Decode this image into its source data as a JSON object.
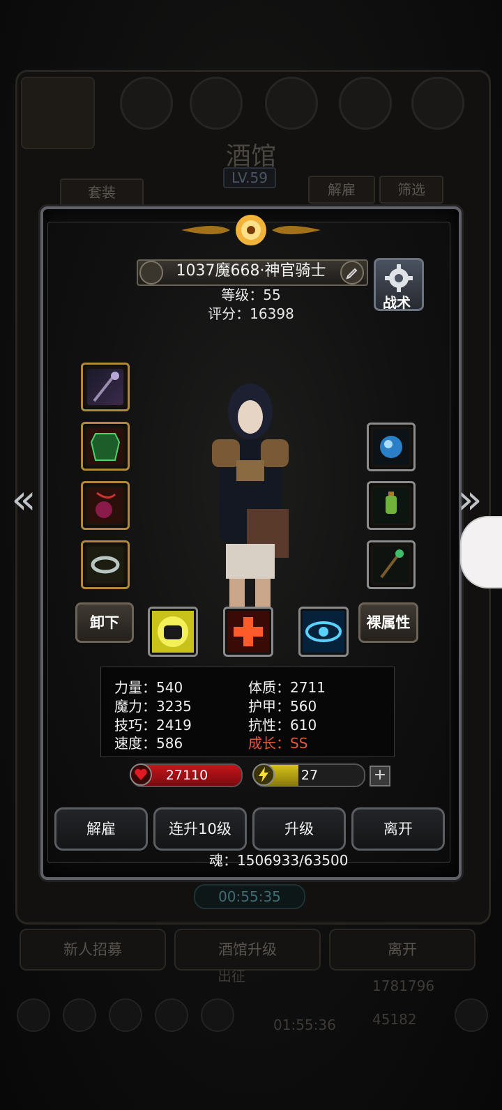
{
  "background": {
    "title": "酒馆",
    "level": "LV.59",
    "set_label": "套装",
    "dismiss_label": "解雇",
    "filter_label": "筛选",
    "timer": "00:55:35",
    "bottom_buttons": [
      "新人招募",
      "酒馆升级",
      "离开"
    ],
    "expedition_label": "出征",
    "gift_timer": "01:55:36",
    "gold": "1781796",
    "gems": "45182"
  },
  "hero": {
    "name": "1037魔668·神官骑士",
    "level_text": "等级：55",
    "score_text": "评分：16398",
    "tactic_label": "战术"
  },
  "equipment": {
    "left": [
      "staff",
      "armor",
      "amulet",
      "ring"
    ],
    "right": [
      "orb",
      "lantern",
      "wand"
    ]
  },
  "actions": {
    "unequip": "卸下",
    "bare_stats": "裸属性"
  },
  "skills": [
    "fist",
    "heal-cross",
    "eye"
  ],
  "stats": {
    "strength": "力量：540",
    "magic": "魔力：3235",
    "skill": "技巧：2419",
    "speed": "速度：586",
    "constitution": "体质：2711",
    "armor": "护甲：560",
    "resistance": "抗性：610",
    "growth": "成长：SS"
  },
  "hp": {
    "value": "27110",
    "fill": 1.0,
    "color": "#c5161c"
  },
  "energy": {
    "value": "27",
    "fill": 0.4,
    "color": "#d6c21a"
  },
  "buttons": {
    "dismiss": "解雇",
    "upgrade10": "连升10级",
    "upgrade": "升级",
    "leave": "离开"
  },
  "soul": "魂：1506933/63500",
  "colors": {
    "accent_gold": "#b08a3a",
    "growth_red": "#e25a3a"
  }
}
